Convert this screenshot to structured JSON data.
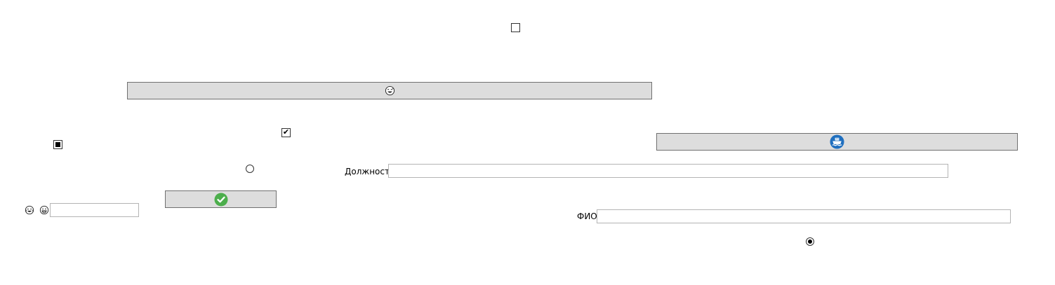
{
  "window": {
    "background": "#ffffff"
  },
  "checkboxes": [
    {
      "state": "unchecked",
      "icon": "checkbox-empty"
    },
    {
      "state": "checked",
      "icon": "checkmark"
    },
    {
      "state": "indeterminate",
      "icon": "checkbox-indeterminate"
    }
  ],
  "radios": [
    {
      "state": "unselected"
    },
    {
      "state": "selected"
    }
  ],
  "buttons": {
    "wide_button_icon": "grinning-face-with-sweat-icon",
    "right_button_icon": "ship-icon",
    "ship_icon_color": "#1f6fbf",
    "ok_button_icon": "green-check-circle-icon",
    "ok_icon_color": "#4cae4c",
    "face": "#dddddd",
    "border": "#707070"
  },
  "fields": {
    "position": {
      "label": "Должность",
      "value": ""
    },
    "fio": {
      "label": "ФИО",
      "value": ""
    },
    "emoji_field": {
      "value": "",
      "icons": [
        "laughing-face-icon",
        "grinning-face-icon"
      ]
    }
  }
}
